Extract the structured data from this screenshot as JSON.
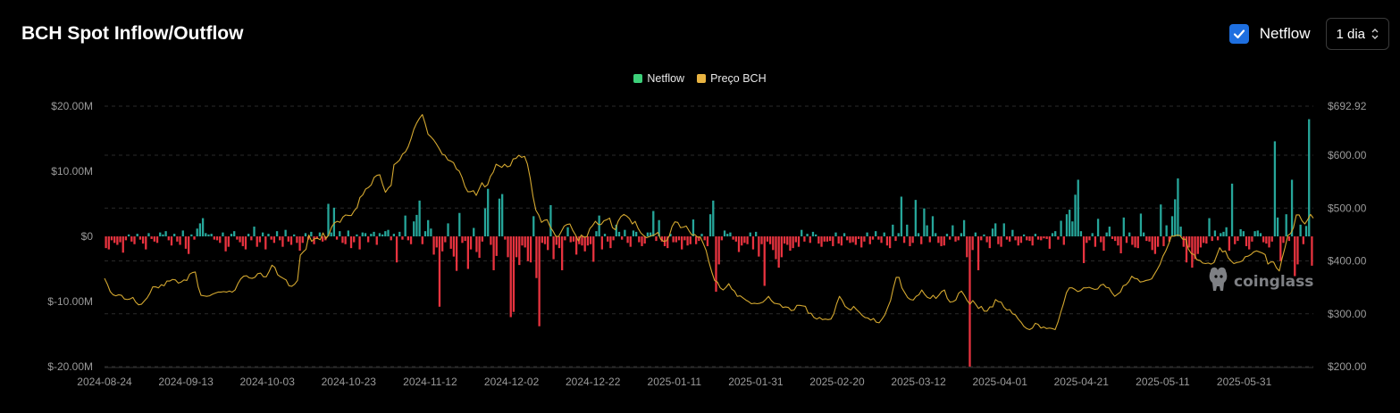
{
  "header": {
    "title": "BCH Spot Inflow/Outflow",
    "toggle_label": "Netflow",
    "toggle_checked": true,
    "interval_value": "1 dia"
  },
  "watermark": "coinglass",
  "colors": {
    "positive": "#26a69a",
    "negative": "#e8333f",
    "price": "#d4a830",
    "legend_netflow": "#3dd07a",
    "legend_price": "#e8b341",
    "checkbox": "#1e6fe0"
  },
  "icons": {
    "checkbox": "check-icon",
    "select": "chevron-updown-icon",
    "watermark": "coinglass-logo-icon"
  },
  "chart_data": {
    "type": "bar+line",
    "legend": [
      "Netflow",
      "Preço BCH"
    ],
    "legend_position": "top-center",
    "grid": true,
    "left_axis": {
      "range": [
        -20000000,
        20000000
      ],
      "ticks": [
        20000000,
        10000000,
        0,
        -10000000,
        -20000000
      ],
      "tick_labels": [
        "$20.00M",
        "$10.00M",
        "$0",
        "$-10.00M",
        "$-20.00M"
      ]
    },
    "right_axis": {
      "range": [
        200,
        692.92
      ],
      "ticks": [
        692.92,
        600,
        500,
        400,
        300,
        200
      ],
      "tick_labels": [
        "$692.92",
        "$600.00",
        "$500.00",
        "$400.00",
        "$300.00",
        "$200.00"
      ]
    },
    "x_tick_labels": [
      "2024-08-24",
      "2024-09-13",
      "2024-10-03",
      "2024-10-23",
      "2024-11-12",
      "2024-12-02",
      "2024-12-22",
      "2025-01-11",
      "2025-01-31",
      "2025-02-20",
      "2025-03-12",
      "2025-04-01",
      "2025-04-21",
      "2025-05-11",
      "2025-05-31"
    ],
    "start_date": "2024-08-24",
    "days": 297,
    "series": [
      {
        "name": "Netflow",
        "unit": "USD millions, daily",
        "values": [
          -1.8,
          -2.0,
          -0.6,
          -1.0,
          -1.3,
          -0.9,
          -2.5,
          -0.6,
          0.3,
          -0.8,
          -1.2,
          0.4,
          -0.5,
          -1.1,
          -2.0,
          0.5,
          -0.4,
          -0.8,
          -1.0,
          0.6,
          0.3,
          0.8,
          -0.6,
          -1.4,
          0.4,
          -0.8,
          -1.3,
          0.9,
          -1.9,
          -2.7,
          0.3,
          -0.5,
          1.2,
          2.0,
          2.8,
          0.5,
          0.3,
          0.4,
          -0.5,
          -0.6,
          -1.0,
          0.6,
          -2.3,
          -1.6,
          0.4,
          0.8,
          -0.5,
          -0.9,
          -1.5,
          -2.0,
          0.4,
          -0.6,
          1.5,
          -1.6,
          -0.9,
          0.6,
          -2.0,
          0.4,
          -0.5,
          -1.0,
          0.8,
          -0.6,
          -1.6,
          1.0,
          -0.8,
          -1.3,
          0.3,
          -1.0,
          -2.2,
          -1.0,
          0.5,
          -0.5,
          0.7,
          -1.2,
          -0.4,
          0.6,
          -0.8,
          -0.6,
          5.0,
          0.6,
          4.4,
          -0.5,
          0.8,
          -1.0,
          -1.2,
          0.9,
          -1.8,
          -0.9,
          0.3,
          -2.0,
          0.6,
          0.5,
          -0.9,
          0.4,
          0.7,
          -1.3,
          0.5,
          0.3,
          0.8,
          1.0,
          -0.6,
          0.4,
          -4.0,
          0.7,
          -0.5,
          3.2,
          -0.6,
          -1.2,
          2.3,
          3.3,
          5.5,
          -1.2,
          0.8,
          2.5,
          1.2,
          -2.8,
          -1.7,
          -10.8,
          -2.3,
          -0.9,
          2.0,
          -1.9,
          -3.1,
          -5.3,
          3.6,
          -1.0,
          -0.7,
          -5.0,
          -2.0,
          1.3,
          -2.4,
          -3.3,
          -0.8,
          4.3,
          7.3,
          -1.3,
          -5.2,
          -3.0,
          5.8,
          6.5,
          -0.5,
          -3.2,
          -12.4,
          -11.6,
          -3.2,
          -4.4,
          -1.4,
          -1.7,
          -3.8,
          -4.0,
          3.1,
          -6.4,
          -13.8,
          -1.0,
          -1.2,
          -2.1,
          4.8,
          -3.5,
          -1.3,
          -1.8,
          -5.2,
          -0.6,
          1.4,
          -0.9,
          -0.8,
          -2.8,
          -1.2,
          -1.4,
          -2.3,
          -1.4,
          -1.2,
          -3.9,
          0.8,
          3.2,
          -2.0,
          0.4,
          -0.8,
          -1.8,
          -0.6,
          1.8,
          0.7,
          -0.5,
          1.0,
          -1.0,
          -1.6,
          0.9,
          0.7,
          -0.9,
          -1.5,
          -1.1,
          0.6,
          0.6,
          3.9,
          -0.7,
          2.5,
          -0.8,
          -1.5,
          -1.8,
          0.4,
          -0.9,
          -0.9,
          -0.6,
          -2.0,
          -0.6,
          -1.4,
          -1.2,
          2.6,
          -1.2,
          -0.7,
          0.4,
          -0.6,
          -1.5,
          3.4,
          5.5,
          -8.5,
          -4.3,
          -0.6,
          0.9,
          0.4,
          0.6,
          -0.5,
          -0.8,
          -2.4,
          -1.4,
          -1.0,
          -1.2,
          0.6,
          -2.0,
          0.7,
          -3.1,
          -1.2,
          -7.6,
          -0.8,
          -1.2,
          -2.1,
          -3.5,
          -4.8,
          -3.2,
          -1.1,
          -1.3,
          -2.2,
          -1.8,
          -0.9,
          -1.6,
          1.0,
          -0.8,
          0.4,
          -1.0,
          0.7,
          0.3,
          -1.1,
          -1.6,
          -0.8,
          -0.8,
          -0.7,
          -1.5,
          0.6,
          -1.1,
          -1.4,
          0.5,
          -0.6,
          -1.0,
          -0.9,
          -1.3,
          -0.4,
          -1.7,
          -0.8,
          0.6,
          -1.2,
          -0.5,
          0.8,
          -0.5,
          -1.0,
          0.6,
          -1.4,
          -1.8,
          1.8,
          -0.7,
          0.5,
          6.1,
          -1.0,
          1.8,
          -1.5,
          -1.0,
          5.6,
          0.5,
          -1.2,
          4.3,
          1.7,
          -0.9,
          3.1,
          0.5,
          -1.0,
          -1.5,
          -1.4,
          0.4,
          -0.5,
          1.7,
          -0.8,
          -0.6,
          0.5,
          2.5,
          -3.2,
          -20.0,
          -2.1,
          0.6,
          -5.2,
          -0.6,
          0.3,
          -0.9,
          -1.8,
          1.2,
          2.0,
          -1.2,
          -1.6,
          2.0,
          -0.5,
          -0.8,
          1.0,
          -0.6,
          -1.4,
          -1.0,
          0.3,
          -0.6,
          -0.7,
          -1.4,
          0.4,
          -0.5,
          -0.6,
          -0.3,
          -0.4,
          -1.9,
          0.5,
          0.8,
          -0.5,
          2.4,
          -1.3,
          3.4,
          4.1,
          2.3,
          6.4,
          8.7,
          0.8,
          -4.1,
          -1.0,
          -0.6,
          0.5,
          -1.6,
          2.7,
          -0.9,
          -2.2,
          0.6,
          1.5,
          -0.4,
          -0.7,
          -1.4,
          -2.6,
          2.9,
          -1.0,
          0.6,
          -1.3,
          -1.7,
          -1.8,
          3.5,
          0.6,
          -0.7,
          -0.8,
          -2.1,
          -2.7,
          -1.6,
          4.9,
          -1.5,
          1.7,
          -0.8,
          3.1,
          5.7,
          8.9,
          1.5,
          -1.6,
          -4.0,
          -1.7,
          -4.8,
          -3.5,
          -2.7,
          -1.7,
          -1.0,
          -1.1,
          2.8,
          -0.7,
          0.9,
          -0.6,
          0.5,
          0.7,
          1.4,
          -2.2,
          8.1,
          -1.2,
          -0.7,
          1.1,
          0.8,
          -1.5,
          -2.0,
          -0.8,
          0.8,
          0.9,
          0.5,
          -0.9,
          -1.1,
          -1.7,
          -0.8,
          14.6,
          2.9,
          -3.8,
          -1.0,
          3.4,
          -0.7,
          8.7,
          -6.1,
          -4.3,
          1.8,
          -1.2,
          1.6,
          18.0,
          -4.5
        ]
      },
      {
        "name": "Preço BCH",
        "unit": "USD",
        "values": [
          367,
          356,
          342,
          336,
          334,
          336,
          335,
          328,
          327,
          328,
          331,
          322,
          317,
          318,
          324,
          330,
          339,
          351,
          351,
          349,
          355,
          353,
          362,
          362,
          365,
          364,
          358,
          360,
          364,
          363,
          375,
          378,
          379,
          351,
          335,
          334,
          333,
          334,
          337,
          339,
          341,
          341,
          342,
          341,
          343,
          341,
          345,
          357,
          366,
          371,
          372,
          368,
          367,
          369,
          376,
          377,
          370,
          370,
          380,
          392,
          388,
          374,
          370,
          367,
          364,
          353,
          352,
          356,
          363,
          411,
          417,
          422,
          449,
          437,
          442,
          443,
          440,
          453,
          442,
          449,
          464,
          472,
          475,
          473,
          483,
          487,
          486,
          486,
          495,
          501,
          520,
          525,
          536,
          539,
          544,
          558,
          562,
          563,
          545,
          530,
          538,
          543,
          582,
          586,
          591,
          602,
          606,
          616,
          631,
          649,
          661,
          670,
          677,
          660,
          640,
          635,
          629,
          621,
          612,
          602,
          600,
          591,
          589,
          586,
          574,
          570,
          558,
          541,
          531,
          531,
          533,
          524,
          536,
          548,
          540,
          544,
          560,
          568,
          583,
          580,
          577,
          583,
          578,
          580,
          593,
          594,
          600,
          596,
          598,
          584,
          557,
          522,
          496,
          487,
          473,
          477,
          478,
          465,
          457,
          447,
          446,
          456,
          466,
          469,
          470,
          458,
          449,
          438,
          449,
          445,
          446,
          461,
          467,
          475,
          469,
          469,
          476,
          478,
          481,
          463,
          459,
          475,
          484,
          488,
          485,
          480,
          470,
          475,
          462,
          453,
          448,
          444,
          446,
          448,
          450,
          454,
          441,
          437,
          438,
          447,
          465,
          474,
          473,
          463,
          464,
          466,
          457,
          449,
          450,
          445,
          445,
          433,
          420,
          398,
          379,
          363,
          360,
          349,
          345,
          350,
          357,
          347,
          343,
          333,
          334,
          330,
          326,
          323,
          319,
          320,
          319,
          320,
          322,
          327,
          333,
          325,
          320,
          319,
          318,
          312,
          313,
          312,
          306,
          307,
          316,
          316,
          315,
          314,
          301,
          301,
          293,
          290,
          293,
          289,
          290,
          289,
          290,
          300,
          319,
          333,
          325,
          314,
          310,
          307,
          314,
          308,
          303,
          297,
          293,
          292,
          288,
          291,
          284,
          283,
          290,
          298,
          312,
          325,
          349,
          369,
          369,
          349,
          340,
          331,
          327,
          326,
          333,
          336,
          345,
          337,
          331,
          329,
          335,
          329,
          335,
          342,
          345,
          329,
          322,
          323,
          326,
          339,
          343,
          335,
          325,
          318,
          325,
          318,
          310,
          314,
          305,
          305,
          313,
          313,
          327,
          323,
          322,
          312,
          307,
          308,
          300,
          298,
          290,
          284,
          276,
          272,
          270,
          273,
          282,
          280,
          273,
          275,
          272,
          273,
          272,
          270,
          284,
          303,
          320,
          340,
          349,
          349,
          346,
          342,
          344,
          349,
          349,
          350,
          348,
          346,
          347,
          354,
          356,
          350,
          349,
          340,
          333,
          337,
          341,
          353,
          355,
          361,
          371,
          367,
          366,
          360,
          361,
          363,
          364,
          366,
          375,
          384,
          394,
          409,
          419,
          432,
          447,
          447,
          449,
          448,
          441,
          441,
          422,
          414,
          412,
          402,
          401,
          396,
          395,
          396,
          394,
          397,
          411,
          425,
          417,
          419,
          406,
          400,
          395,
          397,
          398,
          400,
          408,
          409,
          412,
          417,
          419,
          417,
          415,
          412,
          394,
          398,
          398,
          387,
          381,
          405,
          425,
          448,
          452,
          463,
          487,
          487,
          476,
          470,
          478,
          488,
          481
        ]
      }
    ]
  }
}
